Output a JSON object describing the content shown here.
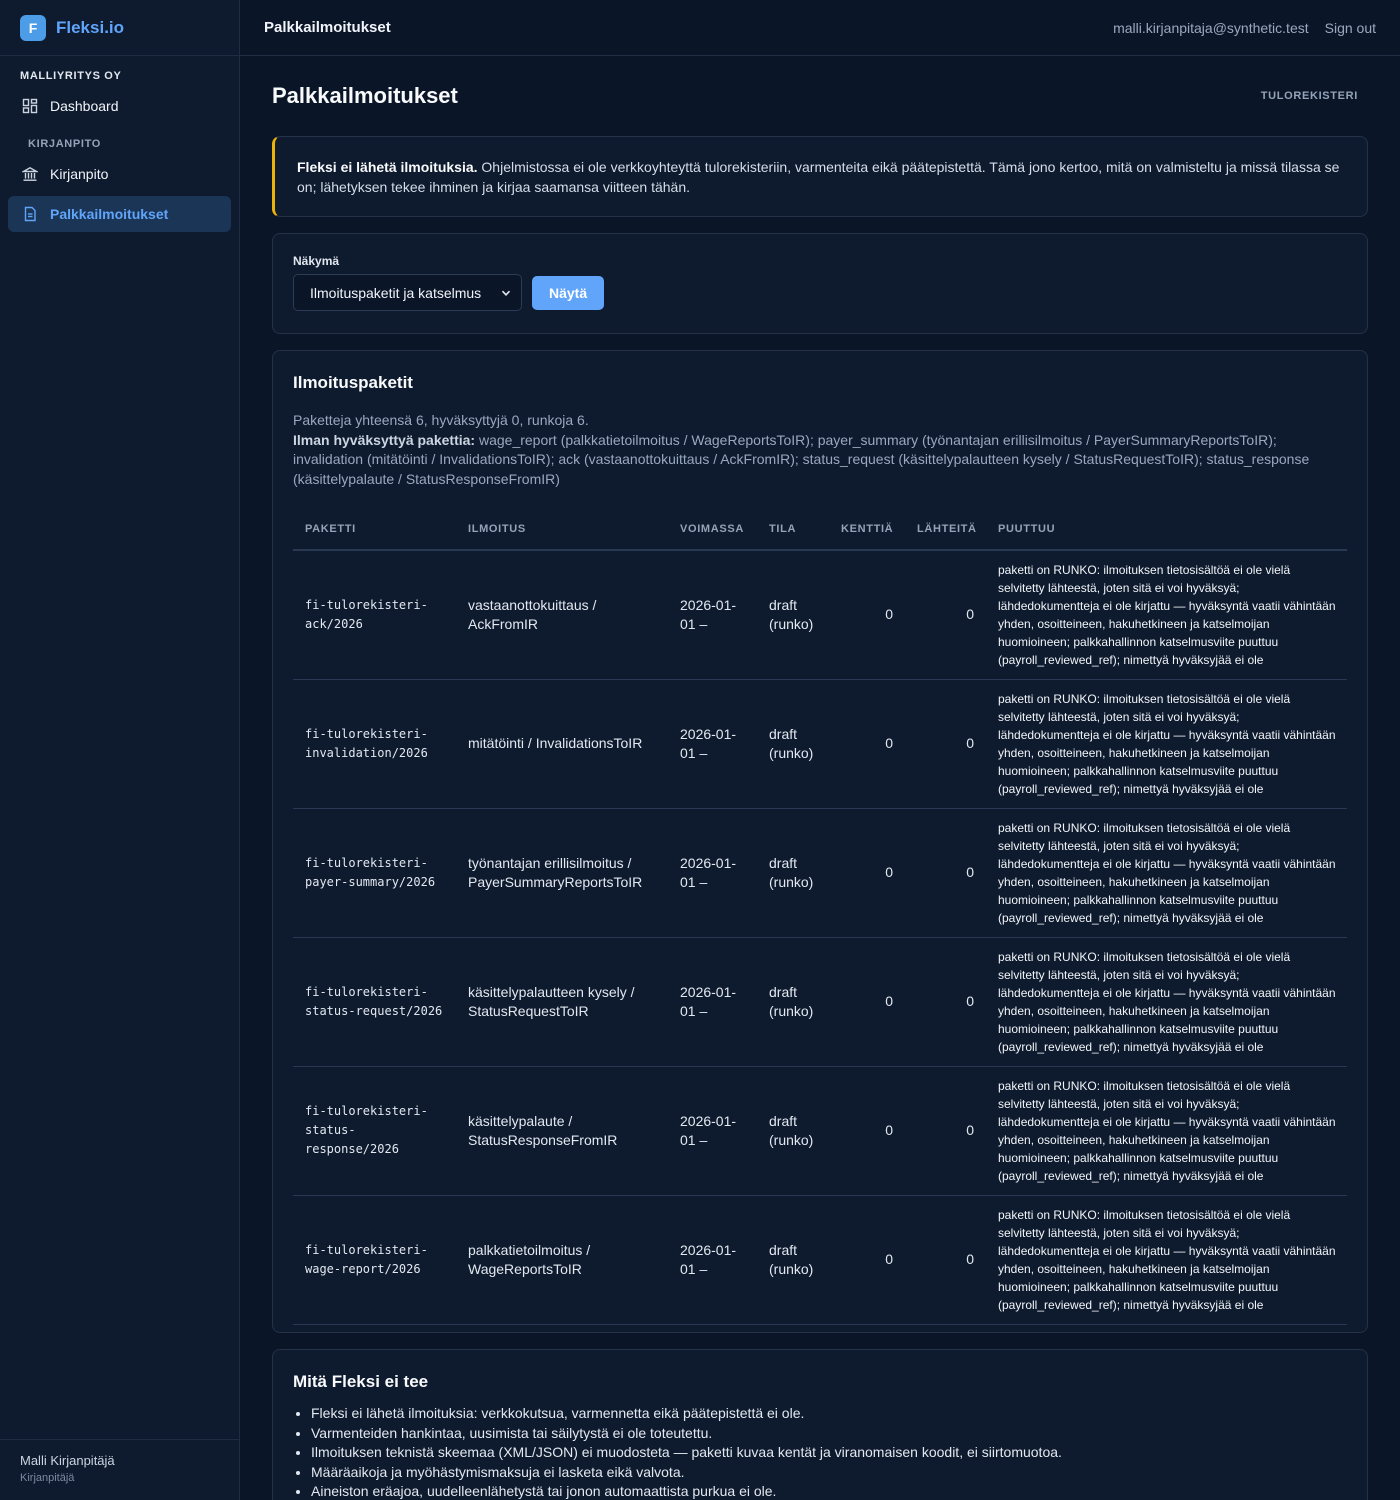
{
  "brand": {
    "logo_letter": "F",
    "name": "Fleksi.io"
  },
  "sidebar": {
    "org": "MALLIYRITYS OY",
    "dashboard_label": "Dashboard",
    "section_label": "KIRJANPITO",
    "items": [
      {
        "label": "Kirjanpito"
      },
      {
        "label": "Palkkailmoitukset"
      }
    ],
    "user": {
      "name": "Malli Kirjanpitäjä",
      "role": "Kirjanpitäjä"
    }
  },
  "topbar": {
    "title": "Palkkailmoitukset",
    "email": "malli.kirjanpitaja@synthetic.test",
    "signout": "Sign out"
  },
  "page": {
    "title": "Palkkailmoitukset",
    "tag": "TULOREKISTERI"
  },
  "notice": {
    "bold": "Fleksi ei lähetä ilmoituksia.",
    "text": " Ohjelmistossa ei ole verkkoyhteyttä tulorekisteriin, varmenteita eikä päätepistettä. Tämä jono kertoo, mitä on valmisteltu ja missä tilassa se on; lähetyksen tekee ihminen ja kirjaa saamansa viitteen tähän."
  },
  "view": {
    "label": "Näkymä",
    "selected": "Ilmoituspaketit ja katselmus",
    "button": "Näytä"
  },
  "packages": {
    "title": "Ilmoituspaketit",
    "summary_line": "Paketteja yhteensä 6, hyväksyttyjä 0, runkoja 6.",
    "missing_label": "Ilman hyväksyttyä pakettia:",
    "missing_text": " wage_report (palkkatietoilmoitus / WageReportsToIR); payer_summary (työnantajan erillisilmoitus / PayerSummaryReportsToIR); invalidation (mitätöinti / InvalidationsToIR); ack (vastaanottokuittaus / AckFromIR); status_request (käsittelypalautteen kysely / StatusRequestToIR); status_response (käsittelypalaute / StatusResponseFromIR)",
    "columns": [
      "PAKETTI",
      "ILMOITUS",
      "VOIMASSA",
      "TILA",
      "KENTTIÄ",
      "LÄHTEITÄ",
      "PUUTTUU"
    ],
    "rows": [
      {
        "package": "fi-tulorekisteri-ack/2026",
        "report": "vastaanottokuittaus / AckFromIR",
        "valid": "2026-01-01 –",
        "status": "draft (runko)",
        "fields": "0",
        "sources": "0",
        "missing": "paketti on RUNKO: ilmoituksen tietosisältöä ei ole vielä selvitetty lähteestä, joten sitä ei voi hyväksyä; lähdedokumentteja ei ole kirjattu — hyväksyntä vaatii vähintään yhden, osoitteineen, hakuhetkineen ja katselmoijan huomioineen; palkkahallinnon katselmusviite puuttuu (payroll_reviewed_ref); nimettyä hyväksyjää ei ole"
      },
      {
        "package": "fi-tulorekisteri-invalidation/2026",
        "report": "mitätöinti / InvalidationsToIR",
        "valid": "2026-01-01 –",
        "status": "draft (runko)",
        "fields": "0",
        "sources": "0",
        "missing": "paketti on RUNKO: ilmoituksen tietosisältöä ei ole vielä selvitetty lähteestä, joten sitä ei voi hyväksyä; lähdedokumentteja ei ole kirjattu — hyväksyntä vaatii vähintään yhden, osoitteineen, hakuhetkineen ja katselmoijan huomioineen; palkkahallinnon katselmusviite puuttuu (payroll_reviewed_ref); nimettyä hyväksyjää ei ole"
      },
      {
        "package": "fi-tulorekisteri-payer-summary/2026",
        "report": "työnantajan erillisilmoitus / PayerSummaryReportsToIR",
        "valid": "2026-01-01 –",
        "status": "draft (runko)",
        "fields": "0",
        "sources": "0",
        "missing": "paketti on RUNKO: ilmoituksen tietosisältöä ei ole vielä selvitetty lähteestä, joten sitä ei voi hyväksyä; lähdedokumentteja ei ole kirjattu — hyväksyntä vaatii vähintään yhden, osoitteineen, hakuhetkineen ja katselmoijan huomioineen; palkkahallinnon katselmusviite puuttuu (payroll_reviewed_ref); nimettyä hyväksyjää ei ole"
      },
      {
        "package": "fi-tulorekisteri-status-request/2026",
        "report": "käsittelypalautteen kysely / StatusRequestToIR",
        "valid": "2026-01-01 –",
        "status": "draft (runko)",
        "fields": "0",
        "sources": "0",
        "missing": "paketti on RUNKO: ilmoituksen tietosisältöä ei ole vielä selvitetty lähteestä, joten sitä ei voi hyväksyä; lähdedokumentteja ei ole kirjattu — hyväksyntä vaatii vähintään yhden, osoitteineen, hakuhetkineen ja katselmoijan huomioineen; palkkahallinnon katselmusviite puuttuu (payroll_reviewed_ref); nimettyä hyväksyjää ei ole"
      },
      {
        "package": "fi-tulorekisteri-status-response/2026",
        "report": "käsittelypalaute / StatusResponseFromIR",
        "valid": "2026-01-01 –",
        "status": "draft (runko)",
        "fields": "0",
        "sources": "0",
        "missing": "paketti on RUNKO: ilmoituksen tietosisältöä ei ole vielä selvitetty lähteestä, joten sitä ei voi hyväksyä; lähdedokumentteja ei ole kirjattu — hyväksyntä vaatii vähintään yhden, osoitteineen, hakuhetkineen ja katselmoijan huomioineen; palkkahallinnon katselmusviite puuttuu (payroll_reviewed_ref); nimettyä hyväksyjää ei ole"
      },
      {
        "package": "fi-tulorekisteri-wage-report/2026",
        "report": "palkkatietoilmoitus / WageReportsToIR",
        "valid": "2026-01-01 –",
        "status": "draft (runko)",
        "fields": "0",
        "sources": "0",
        "missing": "paketti on RUNKO: ilmoituksen tietosisältöä ei ole vielä selvitetty lähteestä, joten sitä ei voi hyväksyä; lähdedokumentteja ei ole kirjattu — hyväksyntä vaatii vähintään yhden, osoitteineen, hakuhetkineen ja katselmoijan huomioineen; palkkahallinnon katselmusviite puuttuu (payroll_reviewed_ref); nimettyä hyväksyjää ei ole"
      }
    ]
  },
  "not_done": {
    "title": "Mitä Fleksi ei tee",
    "items": [
      "Fleksi ei lähetä ilmoituksia: verkkokutsua, varmennetta eikä päätepistettä ei ole.",
      "Varmenteiden hankintaa, uusimista tai säilytystä ei ole toteutettu.",
      "Ilmoituksen teknistä skeemaa (XML/JSON) ei muodosteta — paketti kuvaa kentät ja viranomaisen koodit, ei siirtomuotoa.",
      "Määräaikoja ja myöhästymismaksuja ei lasketa eikä valvota.",
      "Aineiston eräajoa, uudelleenlähetystä tai jonon automaattista purkua ei ole."
    ]
  }
}
